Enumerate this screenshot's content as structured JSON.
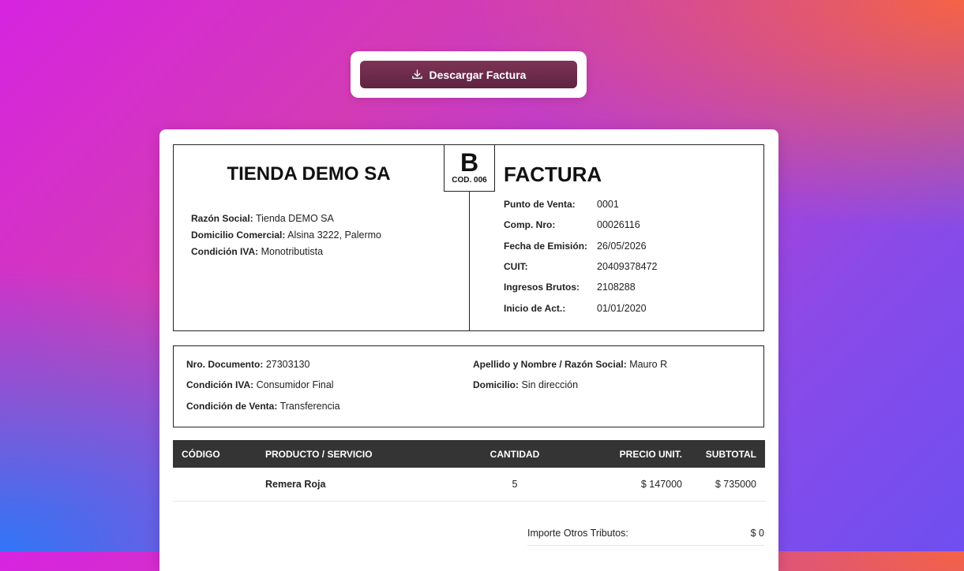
{
  "download_button": {
    "label": "Descargar Factura",
    "icon": "download-icon"
  },
  "invoice": {
    "type_letter": "B",
    "type_code": "COD. 006",
    "company": {
      "name": "TIENDA DEMO SA",
      "fields": [
        {
          "label": "Razón Social:",
          "value": "Tienda DEMO SA"
        },
        {
          "label": "Domicilio Comercial:",
          "value": "Alsina 3222, Palermo"
        },
        {
          "label": "Condición IVA:",
          "value": "Monotributista"
        }
      ]
    },
    "document": {
      "title": "FACTURA",
      "fields": [
        {
          "label": "Punto de Venta:",
          "value": "0001"
        },
        {
          "label": "Comp. Nro:",
          "value": "00026116"
        },
        {
          "label": "Fecha de Emisión:",
          "value": "26/05/2026"
        },
        {
          "label": "CUIT:",
          "value": "20409378472"
        },
        {
          "label": "Ingresos Brutos:",
          "value": "2108288"
        },
        {
          "label": "Inicio de Act.:",
          "value": "01/01/2020"
        }
      ]
    },
    "client": {
      "left": [
        {
          "label": "Nro. Documento:",
          "value": "27303130"
        },
        {
          "label": "Condición IVA:",
          "value": "Consumidor Final"
        },
        {
          "label": "Condición de Venta:",
          "value": "Transferencia"
        }
      ],
      "right": [
        {
          "label": "Apellido y Nombre / Razón Social:",
          "value": "Mauro R"
        },
        {
          "label": "Domicilio:",
          "value": "Sin dirección"
        }
      ]
    },
    "table": {
      "headers": [
        "CÓDIGO",
        "PRODUCTO / SERVICIO",
        "CANTIDAD",
        "PRECIO UNIT.",
        "SUBTOTAL"
      ],
      "rows": [
        {
          "code": "",
          "product": "Remera Roja",
          "quantity": "5",
          "unit_price": "$ 147000",
          "subtotal": "$ 735000"
        }
      ]
    },
    "totals": [
      {
        "label": "Importe Otros Tributos:",
        "value": "$ 0"
      }
    ]
  }
}
